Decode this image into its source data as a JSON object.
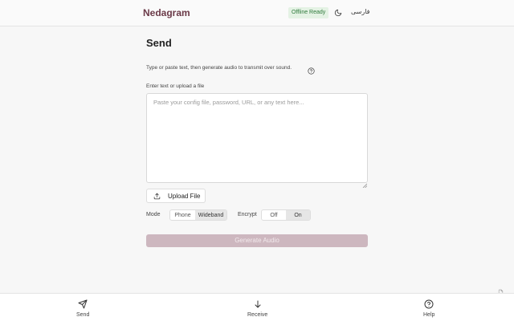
{
  "header": {
    "brand": "Nedagram",
    "status_badge": "Offline Ready",
    "theme_icon": "moon-icon",
    "language": "فارسی"
  },
  "send": {
    "title": "Send",
    "description": "Type or paste text, then generate audio to transmit over sound.",
    "help_icon": "help-circle-icon",
    "input_label": "Enter text or upload a file",
    "input_placeholder": "Paste your config file, password, URL, or any text here...",
    "input_value": "",
    "upload_label": "Upload File",
    "mode_label": "Mode",
    "mode_options": [
      "Phone",
      "Wideband"
    ],
    "mode_selected": "Wideband",
    "encrypt_label": "Encrypt",
    "encrypt_options": [
      "Off",
      "On"
    ],
    "encrypt_selected": "On",
    "generate_label": "Generate Audio"
  },
  "nav": {
    "items": [
      {
        "label": "Send",
        "icon": "send-icon"
      },
      {
        "label": "Receive",
        "icon": "arrow-down-icon"
      },
      {
        "label": "Help",
        "icon": "help-circle-icon"
      }
    ]
  },
  "colors": {
    "brand": "#6b3a48",
    "badge_text": "#2f7a3c",
    "badge_bg": "#e4f2e4",
    "generate_button": "#cdb7bf"
  }
}
